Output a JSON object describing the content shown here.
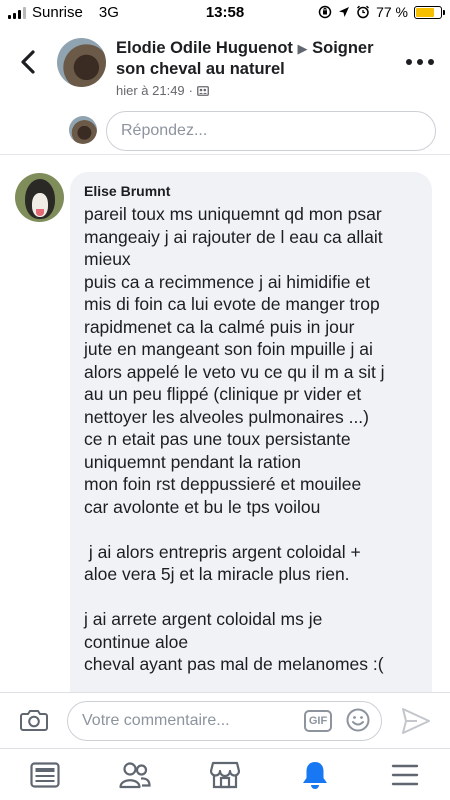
{
  "status_bar": {
    "carrier": "Sunrise",
    "network": "3G",
    "time": "13:58",
    "battery": "77 %",
    "battery_level": 0.77
  },
  "header": {
    "author": "Elodie Odile Huguenot",
    "arrow": "▶",
    "group": "Soigner son cheval au naturel",
    "timestamp": "hier à 21:49",
    "separator": "·"
  },
  "reply": {
    "placeholder": "Répondez..."
  },
  "comment": {
    "author": "Elise Brumnt",
    "lines": [
      "pareil toux ms uniquemnt qd mon psar",
      "mangeaiy j ai rajouter de l eau ca allait",
      "mieux",
      "puis ca a recimmence j ai himidifie et",
      "mis di foin ca lui evote de manger trop",
      "rapidmenet ca la calmé puis in jour",
      "jute en mangeant son foin mpuille j ai",
      "alors appelé le veto vu ce qu il m a sit j",
      "au un peu flippé (clinique pr vider et",
      "nettoyer les alveoles pulmonaires ...)",
      "ce n etait pas une toux persistante",
      "uniquemnt pendant la ration",
      "mon foin rst deppussieré et mouilee",
      "car avolonte et bu le tps voilou",
      "",
      " j ai alors entrepris argent coloidal +",
      "aloe vera 5j et la miracle plus rien.",
      "",
      "j ai arrete argent coloidal ms je",
      "continue aloe",
      "cheval ayant pas mal de melanomes :("
    ]
  },
  "composer": {
    "placeholder": "Votre commentaire...",
    "gif_label": "GIF"
  },
  "tabs": [
    {
      "icon": "news-feed-icon"
    },
    {
      "icon": "friends-icon"
    },
    {
      "icon": "marketplace-icon"
    },
    {
      "icon": "notifications-bell-icon",
      "active": true
    },
    {
      "icon": "menu-icon"
    }
  ],
  "colors": {
    "accent": "#1877f2",
    "bubble": "#f0f2f5",
    "muted": "#8d949e",
    "battery": "#f6c000"
  }
}
